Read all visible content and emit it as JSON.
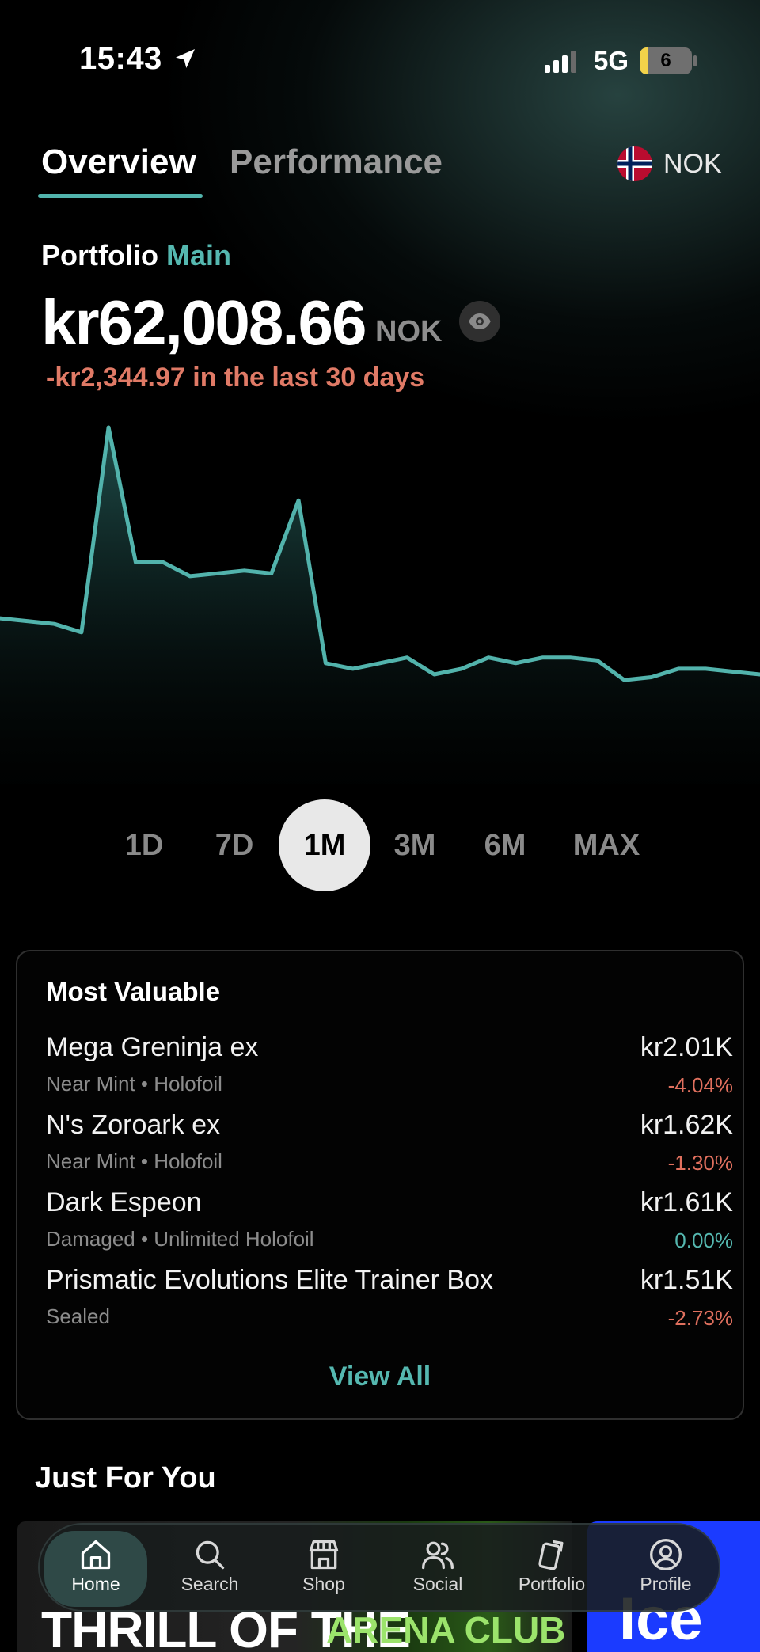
{
  "status": {
    "time": "15:43",
    "network": "5G",
    "battery": "6"
  },
  "tabs": [
    {
      "label": "Overview",
      "active": true
    },
    {
      "label": "Performance",
      "active": false
    }
  ],
  "currency": {
    "label": "NOK",
    "flag": "norway-flag"
  },
  "portfolio": {
    "label": "Portfolio",
    "name": "Main",
    "value": "kr62,008.66",
    "currency": "NOK",
    "change": "-kr2,344.97 in the last 30 days"
  },
  "chart_data": {
    "type": "area",
    "title": "",
    "line_color": "#52b3ac",
    "values": [
      1480,
      1475,
      1470,
      1455,
      1820,
      1580,
      1580,
      1555,
      1560,
      1565,
      1560,
      1690,
      1400,
      1390,
      1400,
      1410,
      1380,
      1390,
      1410,
      1400,
      1410,
      1410,
      1405,
      1370,
      1375,
      1390,
      1390,
      1385,
      1380
    ]
  },
  "ranges": [
    {
      "label": "1D",
      "active": false
    },
    {
      "label": "7D",
      "active": false
    },
    {
      "label": "1M",
      "active": true
    },
    {
      "label": "3M",
      "active": false
    },
    {
      "label": "6M",
      "active": false
    },
    {
      "label": "MAX",
      "active": false
    }
  ],
  "most_valuable": {
    "title": "Most Valuable",
    "items": [
      {
        "name": "Mega Greninja ex",
        "sub": "Near Mint • Holofoil",
        "price": "kr2.01K",
        "change": "-4.04%"
      },
      {
        "name": "N's Zoroark ex",
        "sub": "Near Mint • Holofoil",
        "price": "kr1.62K",
        "change": "-1.30%"
      },
      {
        "name": "Dark Espeon",
        "sub": "Damaged • Unlimited Holofoil",
        "price": "kr1.61K",
        "change": "0.00%"
      },
      {
        "name": "Prismatic Evolutions Elite Trainer Box",
        "sub": "Sealed",
        "price": "kr1.51K",
        "change": "-2.73%"
      }
    ],
    "view_all": "View All"
  },
  "just_for_you": {
    "title": "Just For You",
    "promo_1_text": "THRILL OF THE CHASE",
    "promo_1_text_2": "ARENA CLUB",
    "promo_2_text": "Ice"
  },
  "nav": [
    {
      "label": "Home",
      "icon": "home-icon",
      "active": true
    },
    {
      "label": "Search",
      "icon": "search-icon",
      "active": false
    },
    {
      "label": "Shop",
      "icon": "shop-icon",
      "active": false
    },
    {
      "label": "Social",
      "icon": "people-icon",
      "active": false
    },
    {
      "label": "Portfolio",
      "icon": "cards-icon",
      "active": false
    },
    {
      "label": "Profile",
      "icon": "profile-icon",
      "active": false
    }
  ]
}
